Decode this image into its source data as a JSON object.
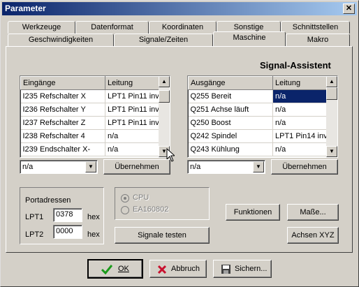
{
  "window": {
    "title": "Parameter",
    "close_glyph": "✕"
  },
  "tabs_row1": [
    "Werkzeuge",
    "Datenformat",
    "Koordinaten",
    "Sonstige",
    "Schnittstellen"
  ],
  "tabs_row2": [
    "Geschwindigkeiten",
    "Signale/Zeiten",
    "Maschine",
    "Makro"
  ],
  "active_tab": "Maschine",
  "heading": "Signal-Assistent",
  "inputs_grid": {
    "headers": [
      "Eingänge",
      "Leitung"
    ],
    "rows": [
      [
        "I235 Refschalter X",
        "LPT1 Pin11 inv"
      ],
      [
        "I236 Refschalter Y",
        "LPT1 Pin11 inv"
      ],
      [
        "I237 Refschalter Z",
        "LPT1 Pin11 inv"
      ],
      [
        "I238 Refschalter 4",
        "n/a"
      ],
      [
        "I239 Endschalter X-",
        "n/a"
      ]
    ]
  },
  "outputs_grid": {
    "headers": [
      "Ausgänge",
      "Leitung"
    ],
    "rows": [
      [
        "Q255 Bereit",
        "n/a"
      ],
      [
        "Q251 Achse läuft",
        "n/a"
      ],
      [
        "Q250 Boost",
        "n/a"
      ],
      [
        "Q242 Spindel",
        "LPT1 Pin14 inv"
      ],
      [
        "Q243 Kühlung",
        "n/a"
      ]
    ],
    "selected_row": 0
  },
  "input_combo": {
    "value": "n/a"
  },
  "output_combo": {
    "value": "n/a"
  },
  "apply_label": "Übernehmen",
  "ports": {
    "title": "Portadressen",
    "lpt1_label": "LPT1",
    "lpt1_value": "0378",
    "lpt2_label": "LPT2",
    "lpt2_value": "0000",
    "unit": "hex"
  },
  "radio": {
    "opt1": "CPU",
    "opt2": "EA160802",
    "selected": "CPU"
  },
  "buttons": {
    "test_signals": "Signale testen",
    "functions": "Funktionen",
    "dimensions": "Maße...",
    "axes": "Achsen XYZ",
    "ok": "OK",
    "cancel": "Abbruch",
    "save": "Sichern..."
  },
  "colors": {
    "selection": "#0a246a",
    "ok_check": "#1a9a1a",
    "cancel_x": "#c8102e",
    "title_start": "#0a246a"
  }
}
